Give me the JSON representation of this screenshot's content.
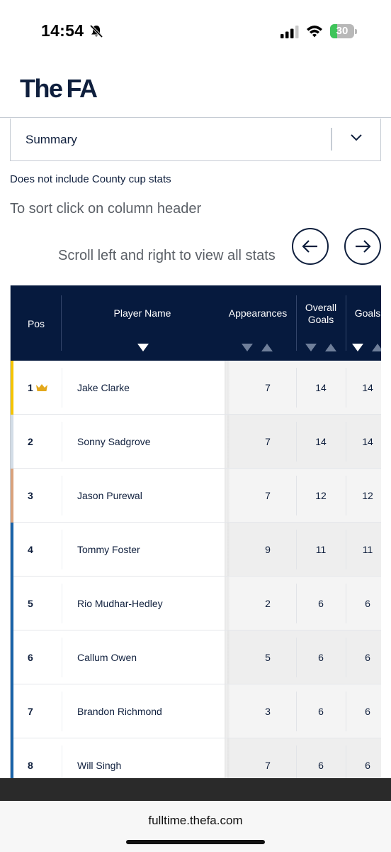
{
  "status_bar": {
    "time": "14:54",
    "battery": "30",
    "battery_level": 0.3
  },
  "header": {
    "logo_the": "The",
    "logo_fa": "FA"
  },
  "filter": {
    "selected": "Summary"
  },
  "notes": {
    "county_cup": "Does not include County cup stats",
    "sort_hint": "To sort click on column header",
    "scroll_hint": "Scroll left and right to view all stats"
  },
  "table": {
    "columns": {
      "pos": "Pos",
      "player": "Player Name",
      "appearances": "Appearances",
      "overall_goals": "Overall Goals",
      "goals": "Goals"
    },
    "rows": [
      {
        "pos": "1",
        "name": "Jake Clarke",
        "appearances": "7",
        "overall_goals": "14",
        "goals": "14",
        "accent": "#f5c400",
        "crown": true
      },
      {
        "pos": "2",
        "name": "Sonny Sadgrove",
        "appearances": "7",
        "overall_goals": "14",
        "goals": "14",
        "accent": "#d3dde7"
      },
      {
        "pos": "3",
        "name": "Jason Purewal",
        "appearances": "7",
        "overall_goals": "12",
        "goals": "12",
        "accent": "#d9a27c"
      },
      {
        "pos": "4",
        "name": "Tommy Foster",
        "appearances": "9",
        "overall_goals": "11",
        "goals": "11",
        "accent": "#1a63a8"
      },
      {
        "pos": "5",
        "name": "Rio Mudhar-Hedley",
        "appearances": "2",
        "overall_goals": "6",
        "goals": "6",
        "accent": "#1a63a8"
      },
      {
        "pos": "6",
        "name": "Callum Owen",
        "appearances": "5",
        "overall_goals": "6",
        "goals": "6",
        "accent": "#1a63a8"
      },
      {
        "pos": "7",
        "name": "Brandon Richmond",
        "appearances": "3",
        "overall_goals": "6",
        "goals": "6",
        "accent": "#1a63a8"
      },
      {
        "pos": "8",
        "name": "Will Singh",
        "appearances": "7",
        "overall_goals": "6",
        "goals": "6",
        "accent": "#1a63a8"
      }
    ]
  },
  "browser": {
    "url": "fulltime.thefa.com"
  },
  "colors": {
    "navy": "#061a3e",
    "text": "#0f1f3d",
    "gold": "#f5c400",
    "row_shade": "#f3f3f3"
  },
  "icons": [
    "bell-slash-icon",
    "signal-icon",
    "wifi-icon",
    "chevron-down-icon",
    "arrow-left-icon",
    "arrow-right-icon",
    "crown-icon",
    "sort-down-icon",
    "sort-up-icon"
  ]
}
